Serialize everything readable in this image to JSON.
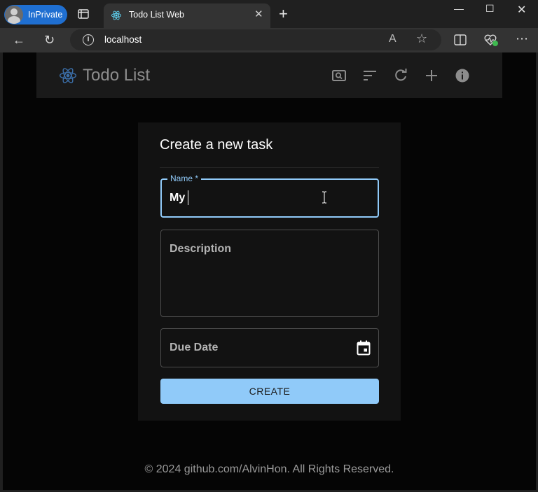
{
  "browser": {
    "profile_label": "InPrivate",
    "tab_title": "Todo List Web",
    "url": "localhost"
  },
  "app": {
    "title": "Todo List",
    "accent": "#90caf9",
    "actions": [
      "search-icon",
      "sort-icon",
      "refresh-icon",
      "add-icon",
      "info-icon"
    ]
  },
  "form": {
    "heading": "Create a new task",
    "name_label": "Name *",
    "name_value": "My",
    "description_placeholder": "Description",
    "due_date_placeholder": "Due Date",
    "create_label": "CREATE"
  },
  "footer": {
    "text": "© 2024 github.com/AlvinHon. All Rights Reserved."
  }
}
